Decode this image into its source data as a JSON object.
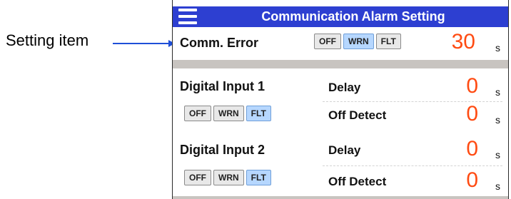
{
  "callout": {
    "label": "Setting item"
  },
  "header": {
    "title": "Communication Alarm Setting",
    "menu_icon": "hamburger-menu-icon"
  },
  "comm_error": {
    "label": "Comm. Error",
    "options": [
      "OFF",
      "WRN",
      "FLT"
    ],
    "selected": "WRN",
    "value": "30",
    "unit": "s"
  },
  "digital_input_1": {
    "label": "Digital Input 1",
    "options": [
      "OFF",
      "WRN",
      "FLT"
    ],
    "selected": "FLT",
    "delay_label": "Delay",
    "delay_value": "0",
    "delay_unit": "s",
    "off_detect_label": "Off Detect",
    "off_detect_value": "0",
    "off_detect_unit": "s"
  },
  "digital_input_2": {
    "label": "Digital Input 2",
    "options": [
      "OFF",
      "WRN",
      "FLT"
    ],
    "selected": "FLT",
    "delay_label": "Delay",
    "delay_value": "0",
    "delay_unit": "s",
    "off_detect_label": "Off Detect",
    "off_detect_value": "0",
    "off_detect_unit": "s"
  },
  "colors": {
    "title_bar": "#2d3fd1",
    "value": "#ff4b12",
    "selected_option": "#b6d7ff",
    "arrow": "#1f4fd8"
  }
}
